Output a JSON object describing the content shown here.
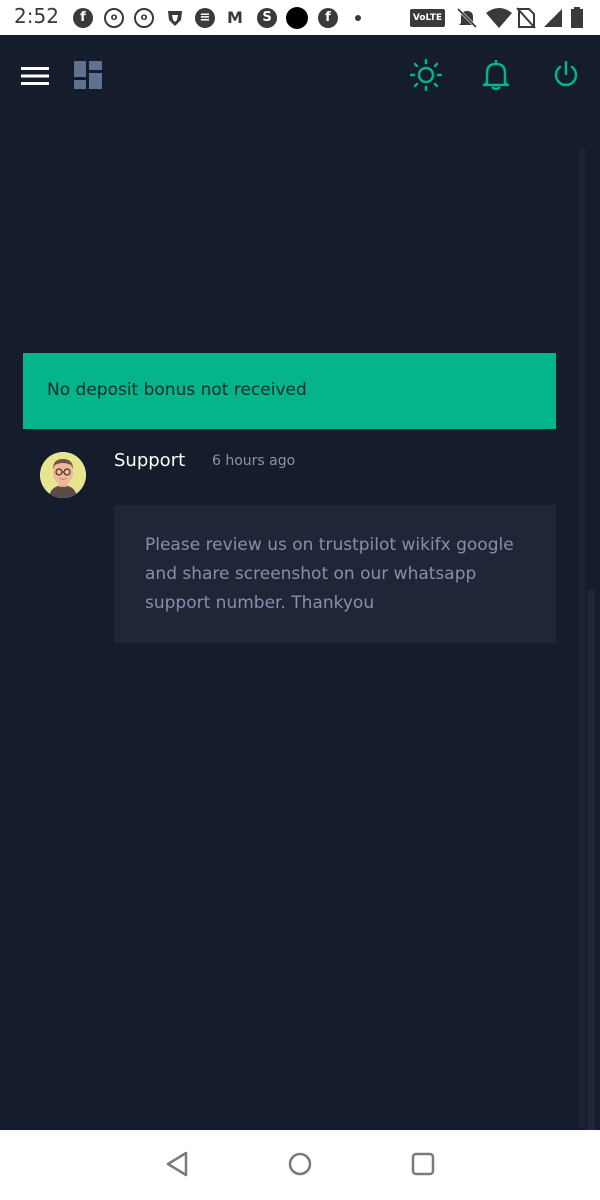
{
  "status_bar": {
    "time": "2:52",
    "volte_label": "VoLTE",
    "icons": [
      "facebook-icon",
      "jio-icon",
      "jio-icon",
      "brave-icon",
      "spotify-icon",
      "gmail-icon",
      "app-icon",
      "black-circle-icon",
      "facebook-icon",
      "dot-icon",
      "volte-icon",
      "bell-off-icon",
      "wifi-icon",
      "no-sim-icon",
      "signal-icon",
      "battery-icon"
    ]
  },
  "header": {
    "icons": [
      "menu-icon",
      "dashboard-icon",
      "brightness-icon",
      "bell-icon",
      "power-icon"
    ],
    "accent_color": "#04b48a"
  },
  "ticket": {
    "title": "No deposit bonus not received"
  },
  "reply": {
    "author": "Support",
    "timestamp": "6 hours ago",
    "message": "Please review us on trustpilot wikifx google and share screenshot on our whatsapp support number. Thankyou"
  },
  "nav_bar": {
    "icons": [
      "back-icon",
      "home-icon",
      "recents-icon"
    ]
  },
  "colors": {
    "background": "#151c2b",
    "banner": "#04b48a",
    "message_box": "#1e2638"
  }
}
